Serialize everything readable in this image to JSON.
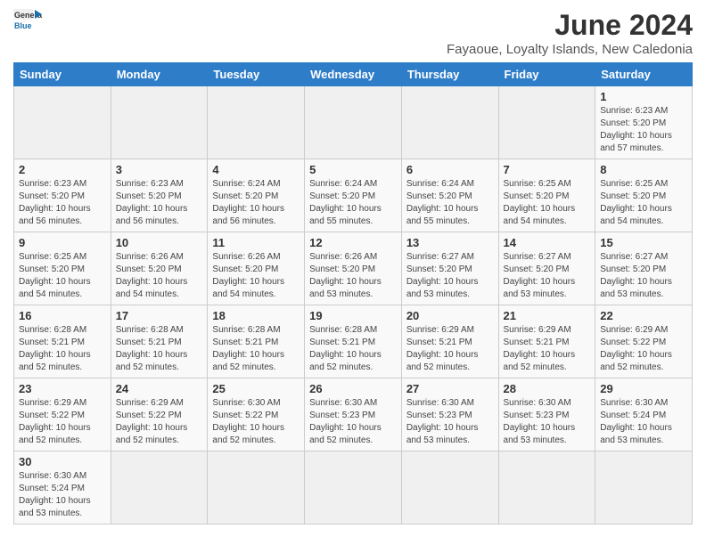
{
  "header": {
    "logo_general": "General",
    "logo_blue": "Blue",
    "month_year": "June 2024",
    "location": "Fayaoue, Loyalty Islands, New Caledonia"
  },
  "days_of_week": [
    "Sunday",
    "Monday",
    "Tuesday",
    "Wednesday",
    "Thursday",
    "Friday",
    "Saturday"
  ],
  "weeks": [
    [
      {
        "day": "",
        "info": ""
      },
      {
        "day": "",
        "info": ""
      },
      {
        "day": "",
        "info": ""
      },
      {
        "day": "",
        "info": ""
      },
      {
        "day": "",
        "info": ""
      },
      {
        "day": "",
        "info": ""
      },
      {
        "day": "1",
        "info": "Sunrise: 6:23 AM\nSunset: 5:20 PM\nDaylight: 10 hours\nand 57 minutes."
      }
    ],
    [
      {
        "day": "2",
        "info": "Sunrise: 6:23 AM\nSunset: 5:20 PM\nDaylight: 10 hours\nand 56 minutes."
      },
      {
        "day": "3",
        "info": "Sunrise: 6:23 AM\nSunset: 5:20 PM\nDaylight: 10 hours\nand 56 minutes."
      },
      {
        "day": "4",
        "info": "Sunrise: 6:24 AM\nSunset: 5:20 PM\nDaylight: 10 hours\nand 56 minutes."
      },
      {
        "day": "5",
        "info": "Sunrise: 6:24 AM\nSunset: 5:20 PM\nDaylight: 10 hours\nand 55 minutes."
      },
      {
        "day": "6",
        "info": "Sunrise: 6:24 AM\nSunset: 5:20 PM\nDaylight: 10 hours\nand 55 minutes."
      },
      {
        "day": "7",
        "info": "Sunrise: 6:25 AM\nSunset: 5:20 PM\nDaylight: 10 hours\nand 54 minutes."
      },
      {
        "day": "8",
        "info": "Sunrise: 6:25 AM\nSunset: 5:20 PM\nDaylight: 10 hours\nand 54 minutes."
      }
    ],
    [
      {
        "day": "9",
        "info": "Sunrise: 6:25 AM\nSunset: 5:20 PM\nDaylight: 10 hours\nand 54 minutes."
      },
      {
        "day": "10",
        "info": "Sunrise: 6:26 AM\nSunset: 5:20 PM\nDaylight: 10 hours\nand 54 minutes."
      },
      {
        "day": "11",
        "info": "Sunrise: 6:26 AM\nSunset: 5:20 PM\nDaylight: 10 hours\nand 54 minutes."
      },
      {
        "day": "12",
        "info": "Sunrise: 6:26 AM\nSunset: 5:20 PM\nDaylight: 10 hours\nand 53 minutes."
      },
      {
        "day": "13",
        "info": "Sunrise: 6:27 AM\nSunset: 5:20 PM\nDaylight: 10 hours\nand 53 minutes."
      },
      {
        "day": "14",
        "info": "Sunrise: 6:27 AM\nSunset: 5:20 PM\nDaylight: 10 hours\nand 53 minutes."
      },
      {
        "day": "15",
        "info": "Sunrise: 6:27 AM\nSunset: 5:20 PM\nDaylight: 10 hours\nand 53 minutes."
      }
    ],
    [
      {
        "day": "16",
        "info": "Sunrise: 6:28 AM\nSunset: 5:21 PM\nDaylight: 10 hours\nand 52 minutes."
      },
      {
        "day": "17",
        "info": "Sunrise: 6:28 AM\nSunset: 5:21 PM\nDaylight: 10 hours\nand 52 minutes."
      },
      {
        "day": "18",
        "info": "Sunrise: 6:28 AM\nSunset: 5:21 PM\nDaylight: 10 hours\nand 52 minutes."
      },
      {
        "day": "19",
        "info": "Sunrise: 6:28 AM\nSunset: 5:21 PM\nDaylight: 10 hours\nand 52 minutes."
      },
      {
        "day": "20",
        "info": "Sunrise: 6:29 AM\nSunset: 5:21 PM\nDaylight: 10 hours\nand 52 minutes."
      },
      {
        "day": "21",
        "info": "Sunrise: 6:29 AM\nSunset: 5:21 PM\nDaylight: 10 hours\nand 52 minutes."
      },
      {
        "day": "22",
        "info": "Sunrise: 6:29 AM\nSunset: 5:22 PM\nDaylight: 10 hours\nand 52 minutes."
      }
    ],
    [
      {
        "day": "23",
        "info": "Sunrise: 6:29 AM\nSunset: 5:22 PM\nDaylight: 10 hours\nand 52 minutes."
      },
      {
        "day": "24",
        "info": "Sunrise: 6:29 AM\nSunset: 5:22 PM\nDaylight: 10 hours\nand 52 minutes."
      },
      {
        "day": "25",
        "info": "Sunrise: 6:30 AM\nSunset: 5:22 PM\nDaylight: 10 hours\nand 52 minutes."
      },
      {
        "day": "26",
        "info": "Sunrise: 6:30 AM\nSunset: 5:23 PM\nDaylight: 10 hours\nand 52 minutes."
      },
      {
        "day": "27",
        "info": "Sunrise: 6:30 AM\nSunset: 5:23 PM\nDaylight: 10 hours\nand 53 minutes."
      },
      {
        "day": "28",
        "info": "Sunrise: 6:30 AM\nSunset: 5:23 PM\nDaylight: 10 hours\nand 53 minutes."
      },
      {
        "day": "29",
        "info": "Sunrise: 6:30 AM\nSunset: 5:24 PM\nDaylight: 10 hours\nand 53 minutes."
      }
    ],
    [
      {
        "day": "30",
        "info": "Sunrise: 6:30 AM\nSunset: 5:24 PM\nDaylight: 10 hours\nand 53 minutes."
      },
      {
        "day": "",
        "info": ""
      },
      {
        "day": "",
        "info": ""
      },
      {
        "day": "",
        "info": ""
      },
      {
        "day": "",
        "info": ""
      },
      {
        "day": "",
        "info": ""
      },
      {
        "day": "",
        "info": ""
      }
    ]
  ]
}
